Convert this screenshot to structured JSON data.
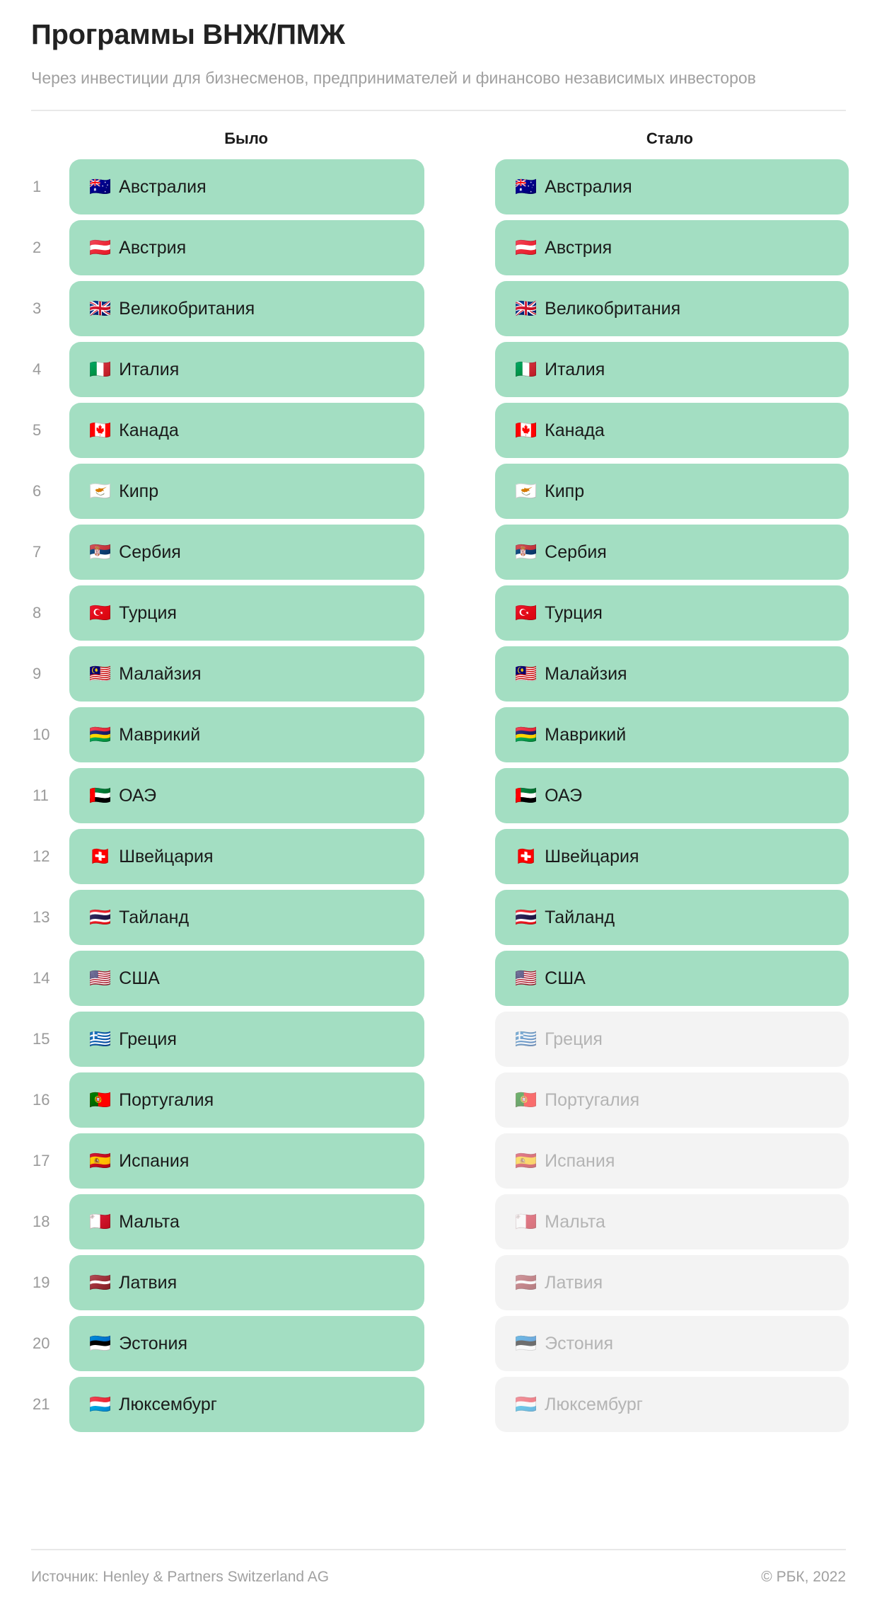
{
  "header": {
    "title": "Программы ВНЖ/ПМЖ",
    "subtitle": "Через инвестиции для бизнесменов, предпринимателей и финансово независимых инвесторов"
  },
  "columns": {
    "left_label": "Было",
    "right_label": "Стало"
  },
  "colors": {
    "pill_active": "#a3dec2",
    "pill_inactive": "#f3f3f3",
    "text_active": "#1a1a1a",
    "text_inactive": "#b4b4b4",
    "rank": "#9a9a9a",
    "muted": "#a0a0a0",
    "rule": "#e8e8e8"
  },
  "rows": [
    {
      "rank": "1",
      "flag": "🇦🇺",
      "flag_name": "flag-australia",
      "country": "Австралия",
      "left_active": true,
      "right_active": true
    },
    {
      "rank": "2",
      "flag": "🇦🇹",
      "flag_name": "flag-austria",
      "country": "Австрия",
      "left_active": true,
      "right_active": true
    },
    {
      "rank": "3",
      "flag": "🇬🇧",
      "flag_name": "flag-united-kingdom",
      "country": "Великобритания",
      "left_active": true,
      "right_active": true
    },
    {
      "rank": "4",
      "flag": "🇮🇹",
      "flag_name": "flag-italy",
      "country": "Италия",
      "left_active": true,
      "right_active": true
    },
    {
      "rank": "5",
      "flag": "🇨🇦",
      "flag_name": "flag-canada",
      "country": "Канада",
      "left_active": true,
      "right_active": true
    },
    {
      "rank": "6",
      "flag": "🇨🇾",
      "flag_name": "flag-cyprus",
      "country": "Кипр",
      "left_active": true,
      "right_active": true
    },
    {
      "rank": "7",
      "flag": "🇷🇸",
      "flag_name": "flag-serbia",
      "country": "Сербия",
      "left_active": true,
      "right_active": true
    },
    {
      "rank": "8",
      "flag": "🇹🇷",
      "flag_name": "flag-turkey",
      "country": "Турция",
      "left_active": true,
      "right_active": true
    },
    {
      "rank": "9",
      "flag": "🇲🇾",
      "flag_name": "flag-malaysia",
      "country": "Малайзия",
      "left_active": true,
      "right_active": true
    },
    {
      "rank": "10",
      "flag": "🇲🇺",
      "flag_name": "flag-mauritius",
      "country": "Маврикий",
      "left_active": true,
      "right_active": true
    },
    {
      "rank": "11",
      "flag": "🇦🇪",
      "flag_name": "flag-uae",
      "country": "ОАЭ",
      "left_active": true,
      "right_active": true
    },
    {
      "rank": "12",
      "flag": "🇨🇭",
      "flag_name": "flag-switzerland",
      "country": "Швейцария",
      "left_active": true,
      "right_active": true
    },
    {
      "rank": "13",
      "flag": "🇹🇭",
      "flag_name": "flag-thailand",
      "country": "Тайланд",
      "left_active": true,
      "right_active": true
    },
    {
      "rank": "14",
      "flag": "🇺🇸",
      "flag_name": "flag-usa",
      "country": "США",
      "left_active": true,
      "right_active": true
    },
    {
      "rank": "15",
      "flag": "🇬🇷",
      "flag_name": "flag-greece",
      "country": "Греция",
      "left_active": true,
      "right_active": false
    },
    {
      "rank": "16",
      "flag": "🇵🇹",
      "flag_name": "flag-portugal",
      "country": "Португалия",
      "left_active": true,
      "right_active": false
    },
    {
      "rank": "17",
      "flag": "🇪🇸",
      "flag_name": "flag-spain",
      "country": "Испания",
      "left_active": true,
      "right_active": false
    },
    {
      "rank": "18",
      "flag": "🇲🇹",
      "flag_name": "flag-malta",
      "country": "Мальта",
      "left_active": true,
      "right_active": false
    },
    {
      "rank": "19",
      "flag": "🇱🇻",
      "flag_name": "flag-latvia",
      "country": "Латвия",
      "left_active": true,
      "right_active": false
    },
    {
      "rank": "20",
      "flag": "🇪🇪",
      "flag_name": "flag-estonia",
      "country": "Эстония",
      "left_active": true,
      "right_active": false
    },
    {
      "rank": "21",
      "flag": "🇱🇺",
      "flag_name": "flag-luxembourg",
      "country": "Люксембург",
      "left_active": true,
      "right_active": false
    }
  ],
  "footer": {
    "source": "Источник: Henley & Partners Switzerland AG",
    "copyright": "© РБК, 2022"
  }
}
